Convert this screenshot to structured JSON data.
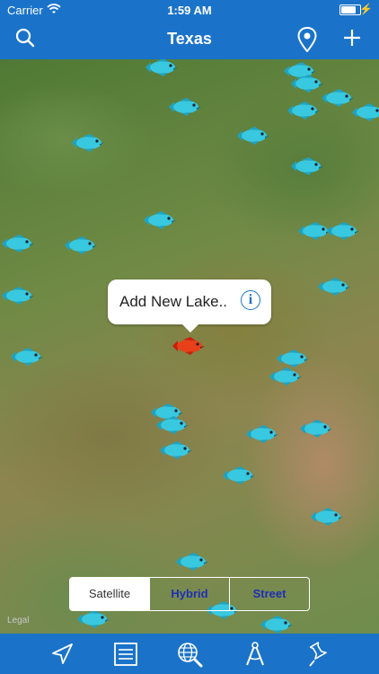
{
  "status_bar": {
    "carrier": "Carrier",
    "time": "1:59 AM"
  },
  "nav": {
    "title": "Texas",
    "search_icon": "search-icon",
    "location_icon": "location-pin-icon",
    "add_icon": "plus-icon"
  },
  "callout": {
    "text": "Add New Lake..",
    "info_icon": "info-icon"
  },
  "map_type": {
    "options": [
      "Satellite",
      "Hybrid",
      "Street"
    ],
    "selected": "Satellite"
  },
  "legal": "Legal",
  "tab_bar": {
    "items": [
      {
        "icon": "navigation-arrow-icon"
      },
      {
        "icon": "list-icon"
      },
      {
        "icon": "globe-search-icon"
      },
      {
        "icon": "compass-tool-icon"
      },
      {
        "icon": "pushpin-icon"
      }
    ]
  },
  "colors": {
    "primary": "#1a73c9",
    "lake_marker": "#38c8e0",
    "new_lake_marker": "#e8401a"
  }
}
